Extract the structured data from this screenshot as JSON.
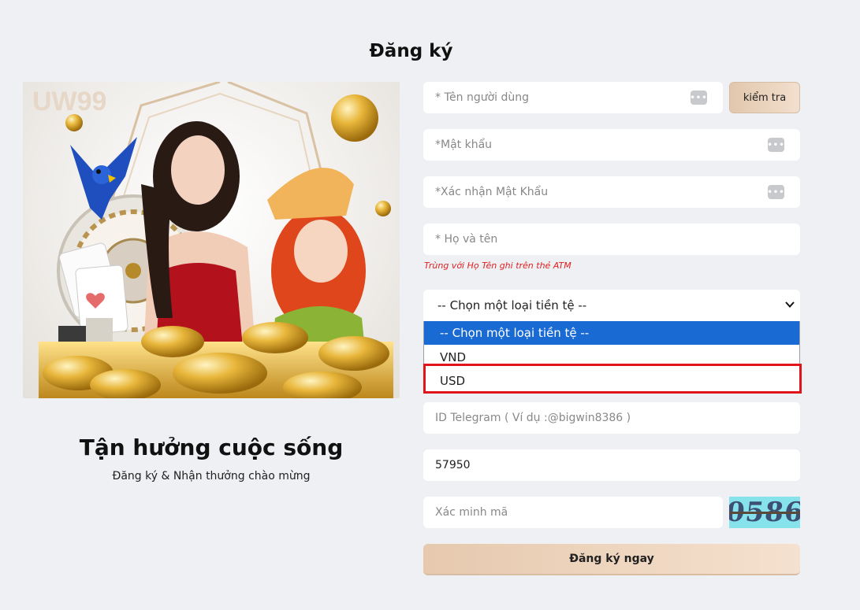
{
  "page": {
    "title": "Đăng ký"
  },
  "promo": {
    "brand": "UW99",
    "tagline": "Tận hưởng cuộc sống",
    "subtagline": "Đăng ký & Nhận thưởng chào mừng"
  },
  "form": {
    "username": {
      "placeholder": "* Tên người dùng"
    },
    "check_label": "kiểm tra",
    "password": {
      "placeholder": "*Mật khẩu"
    },
    "confirm_password": {
      "placeholder": "*Xác nhận Mật Khẩu"
    },
    "fullname": {
      "placeholder": "* Họ và tên"
    },
    "fullname_hint": "Trùng với Họ Tên ghi trên thẻ ATM",
    "currency": {
      "selected": "-- Chọn một loại tiền tệ --",
      "options": [
        "-- Chọn một loại tiền tệ --",
        "VND",
        "USD"
      ],
      "highlighted_option": "USD"
    },
    "telegram": {
      "placeholder": "ID Telegram ( Ví dụ :@bigwin8386 )"
    },
    "code_value": "57950",
    "verify": {
      "placeholder": "Xác minh mã"
    },
    "captcha_text": "0586",
    "submit_label": "Đăng ký ngay"
  },
  "colors": {
    "accent_gold": "#e6c9ae",
    "selected_option": "#1a6ad3",
    "highlight": "#e1141c",
    "hint": "#e02020"
  }
}
